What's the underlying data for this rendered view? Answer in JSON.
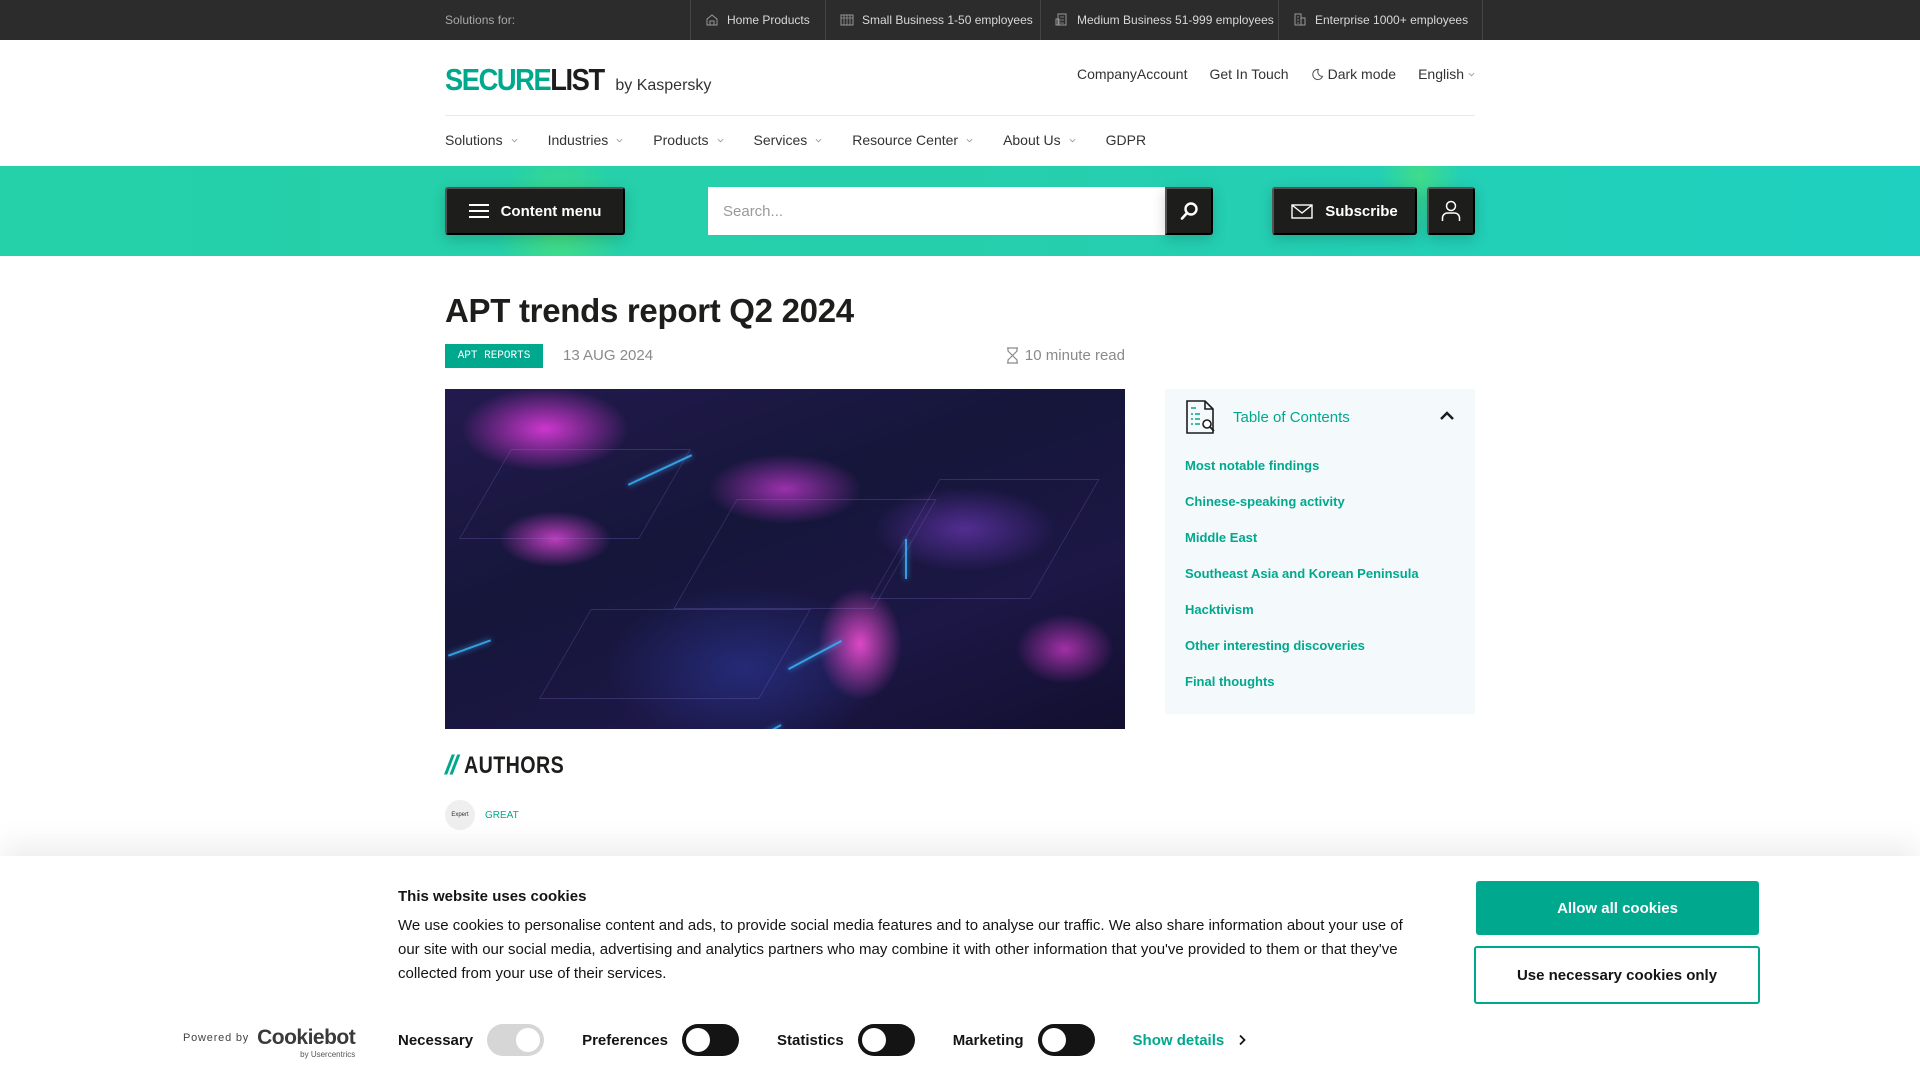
{
  "topbar": {
    "label": "Solutions for:",
    "items": [
      {
        "label": "Home Products",
        "icon": "home-icon"
      },
      {
        "label": "Small Business 1-50 employees",
        "icon": "small-building-icon"
      },
      {
        "label": "Medium Business 51-999 employees",
        "icon": "medium-building-icon"
      },
      {
        "label": "Enterprise 1000+ employees",
        "icon": "enterprise-building-icon"
      }
    ]
  },
  "header": {
    "logo_secure": "SECURE",
    "logo_list": "LIST",
    "logo_by": "by Kaspersky",
    "util": {
      "company_account": "CompanyAccount",
      "get_in_touch": "Get In Touch",
      "dark_mode": "Dark mode",
      "language": "English"
    },
    "nav": [
      "Solutions",
      "Industries",
      "Products",
      "Services",
      "Resource Center",
      "About Us",
      "GDPR"
    ]
  },
  "band": {
    "content_menu": "Content menu",
    "search_placeholder": "Search...",
    "subscribe": "Subscribe"
  },
  "article": {
    "title": "APT trends report Q2 2024",
    "tag": "APT REPORTS",
    "date": "13 AUG 2024",
    "read_time": "10 minute read"
  },
  "toc": {
    "title": "Table of Contents",
    "items": [
      "Most notable findings",
      "Chinese-speaking activity",
      "Middle East",
      "Southeast Asia and Korean Peninsula",
      "Hacktivism",
      "Other interesting discoveries",
      "Final thoughts"
    ]
  },
  "authors": {
    "heading": "AUTHORS",
    "slashes": "//",
    "list": [
      {
        "avatar_text": "Expert",
        "name": "GREAT"
      }
    ]
  },
  "cookie": {
    "title": "This website uses cookies",
    "text": "We use cookies to personalise content and ads, to provide social media features and to analyse our traffic. We also share information about your use of our site with our social media, advertising and analytics partners who may combine it with other information that you've provided to them or that they've collected from your use of their services.",
    "powered_by": "Powered by",
    "brand": "Cookiebot",
    "brand_sub": "by Usercentrics",
    "toggles": [
      {
        "label": "Necessary",
        "on": true,
        "disabled": true
      },
      {
        "label": "Preferences",
        "on": false
      },
      {
        "label": "Statistics",
        "on": false
      },
      {
        "label": "Marketing",
        "on": false
      }
    ],
    "show_details": "Show details",
    "allow_all": "Allow all cookies",
    "necessary_only": "Use necessary cookies only"
  },
  "colors": {
    "accent": "#00a88e",
    "dark": "#1d1d1b",
    "topbar": "#2c2c2c",
    "band": "#24d1a8"
  }
}
